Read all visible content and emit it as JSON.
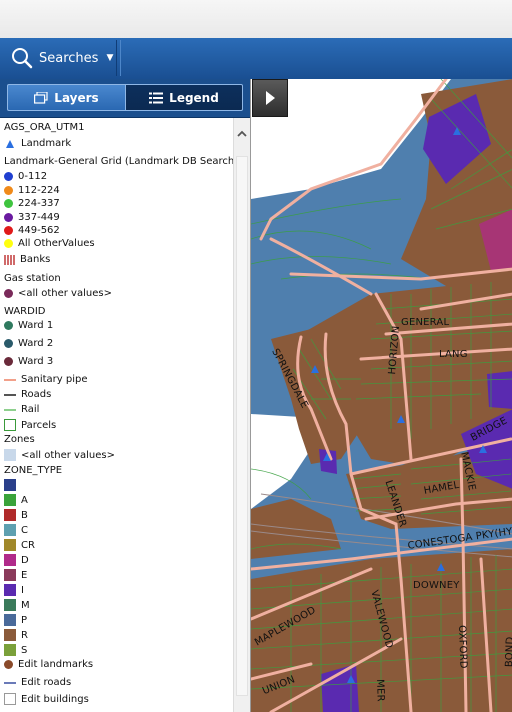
{
  "toolbar": {
    "searches_label": "Searches"
  },
  "tabs": {
    "layers": "Layers",
    "legend": "Legend"
  },
  "legend": {
    "rows": [
      {
        "label": "AGS_ORA_UTM1",
        "symbol": "none"
      },
      {
        "label": "Landmark",
        "symbol": "triangle",
        "color": "#2a6fe0"
      },
      {
        "label": "Landmark-General Grid (Landmark DB Search)",
        "symbol": "none"
      },
      {
        "label": "0-112",
        "symbol": "dot",
        "color": "#1f3fd0"
      },
      {
        "label": "112-224",
        "symbol": "dot",
        "color": "#f08a1a"
      },
      {
        "label": "224-337",
        "symbol": "dot",
        "color": "#3fc43f"
      },
      {
        "label": "337-449",
        "symbol": "dot",
        "color": "#6a1aa0"
      },
      {
        "label": "449-562",
        "symbol": "dot",
        "color": "#e01a1a"
      },
      {
        "label": "All OtherValues",
        "symbol": "dot",
        "color": "#ffff10"
      },
      {
        "label": "Banks",
        "symbol": "bank",
        "color": "#d06a6a"
      },
      {
        "label": "Gas station",
        "symbol": "none"
      },
      {
        "label": "<all other values>",
        "symbol": "dot",
        "color": "#7a2a5a"
      },
      {
        "label": "WARDID",
        "symbol": "none"
      },
      {
        "label": "Ward 1",
        "symbol": "dot",
        "color": "#2f7a5f"
      },
      {
        "label": "Ward 2",
        "symbol": "dot",
        "color": "#2a5a6a"
      },
      {
        "label": "Ward 3",
        "symbol": "dot",
        "color": "#6a2a3a"
      },
      {
        "label": "Sanitary pipe",
        "symbol": "line",
        "color": "#f2a08a"
      },
      {
        "label": "Roads",
        "symbol": "line",
        "color": "#555555"
      },
      {
        "label": "Rail",
        "symbol": "line",
        "color": "#8ed08e"
      },
      {
        "label": "Parcels",
        "symbol": "box",
        "color": "#3a9a3a"
      },
      {
        "label": "Zones",
        "symbol": "none"
      },
      {
        "label": "<all other values>",
        "symbol": "square",
        "color": "#c8d8ea"
      },
      {
        "label": "ZONE_TYPE",
        "symbol": "none"
      },
      {
        "label": "",
        "symbol": "square",
        "color": "#2a3f8a"
      },
      {
        "label": "A",
        "symbol": "square",
        "color": "#3aa33a"
      },
      {
        "label": "B",
        "symbol": "square",
        "color": "#b02a2a"
      },
      {
        "label": "C",
        "symbol": "square",
        "color": "#5ea0b0"
      },
      {
        "label": "CR",
        "symbol": "square",
        "color": "#a0882a"
      },
      {
        "label": "D",
        "symbol": "square",
        "color": "#b02a8a"
      },
      {
        "label": "E",
        "symbol": "square",
        "color": "#8a3a5a"
      },
      {
        "label": "I",
        "symbol": "square",
        "color": "#5a2ab0"
      },
      {
        "label": "M",
        "symbol": "square",
        "color": "#3a7a5a"
      },
      {
        "label": "P",
        "symbol": "square",
        "color": "#4a6a9a"
      },
      {
        "label": "R",
        "symbol": "square",
        "color": "#8a5a3a"
      },
      {
        "label": "S",
        "symbol": "square",
        "color": "#7aa03a"
      },
      {
        "label": "Edit landmarks",
        "symbol": "dot",
        "color": "#8a4a2a"
      },
      {
        "label": "Edit roads",
        "symbol": "line",
        "color": "#6a7ab8"
      },
      {
        "label": "Edit buildings",
        "symbol": "box",
        "color": "#999999"
      }
    ]
  },
  "map": {
    "colors": {
      "water": "#4f7fae",
      "land": "#8a5a3a",
      "road": "#f0b0a0",
      "parcel_line": "#3aa040",
      "zone_i": "#5a2ab0",
      "zone_d": "#b02a8a"
    },
    "streets": [
      "GENERAL",
      "LANG",
      "HORIZON",
      "SPRINGDALE",
      "BRIDGE",
      "MACKIE",
      "LEANDER",
      "HAMEL",
      "CONESTOGA PKY(HY",
      "DOWNEY",
      "VALEWOOD",
      "MAPLEWOOD",
      "OXFORD",
      "UNION",
      "BOND",
      "MER"
    ]
  }
}
